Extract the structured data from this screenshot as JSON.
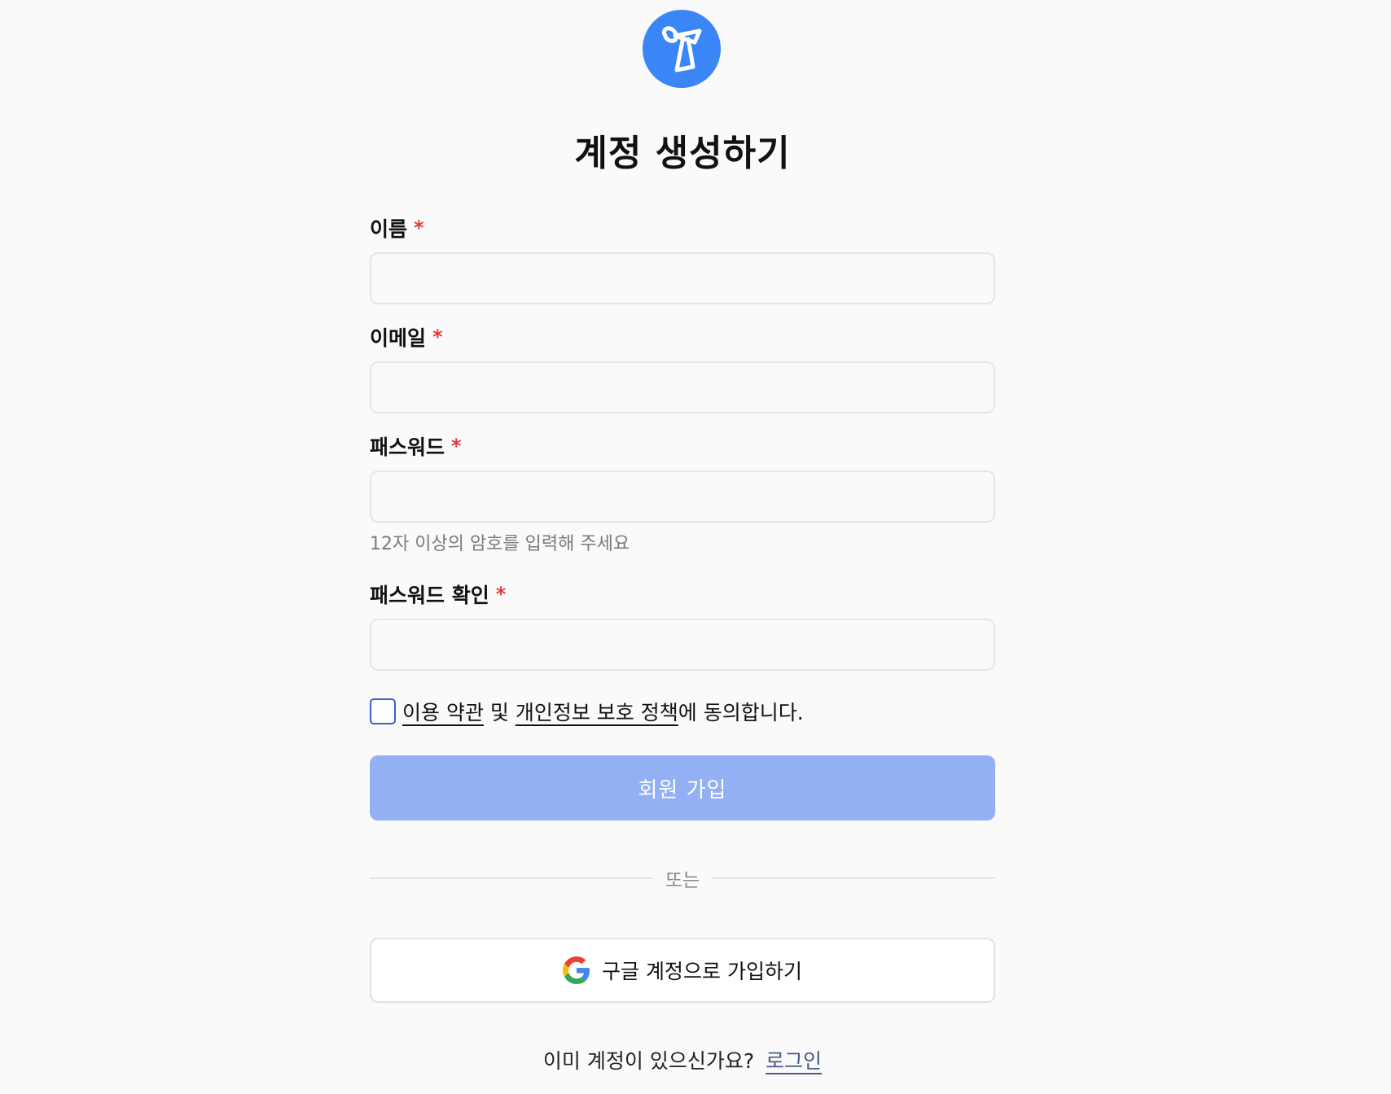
{
  "logo": {
    "icon": "ribbon-logo-icon",
    "color": "#3b86f6"
  },
  "page_title": "계정 생성하기",
  "fields": {
    "name": {
      "label": "이름",
      "required_mark": "*",
      "value": "",
      "placeholder": ""
    },
    "email": {
      "label": "이메일",
      "required_mark": "*",
      "value": "",
      "placeholder": ""
    },
    "password": {
      "label": "패스워드",
      "required_mark": "*",
      "value": "",
      "placeholder": "",
      "hint": "12자 이상의 암호를 입력해 주세요"
    },
    "password_confirm": {
      "label": "패스워드 확인",
      "required_mark": "*",
      "value": "",
      "placeholder": ""
    }
  },
  "agreement": {
    "checked": false,
    "terms_link": "이용 약관",
    "connector": " 및 ",
    "privacy_link": "개인정보 보호 정책",
    "suffix": "에 동의합니다."
  },
  "submit_label": "회원 가입",
  "divider_text": "또는",
  "google_button": {
    "label": "구글 계정으로 가입하기",
    "icon": "google-icon"
  },
  "footer": {
    "question": "이미 계정이 있으신가요?",
    "login_link": "로그인"
  },
  "colors": {
    "accent": "#3b86f6",
    "submit_disabled": "#93b0f5",
    "required": "#e23b3b",
    "checkbox_border": "#2f64d1"
  }
}
